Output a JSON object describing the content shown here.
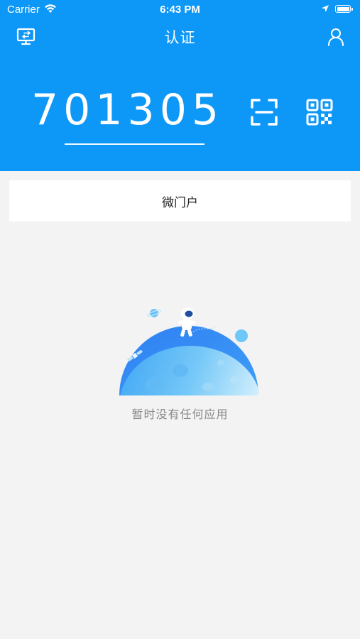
{
  "status_bar": {
    "carrier": "Carrier",
    "time": "6:43 PM"
  },
  "navbar": {
    "title": "认证",
    "left_icon": "monitor-switch-icon",
    "right_icon": "user-icon"
  },
  "auth": {
    "code": "701305",
    "scan_icon": "scan-icon",
    "qr_icon": "qr-code-icon"
  },
  "portal_tab": {
    "label": "微门户"
  },
  "empty_state": {
    "message": "暂时没有任何应用",
    "illustration": "astronaut-moon-illustration"
  },
  "colors": {
    "primary": "#0d97f7",
    "background": "#f3f3f4",
    "empty_text": "#888888"
  }
}
